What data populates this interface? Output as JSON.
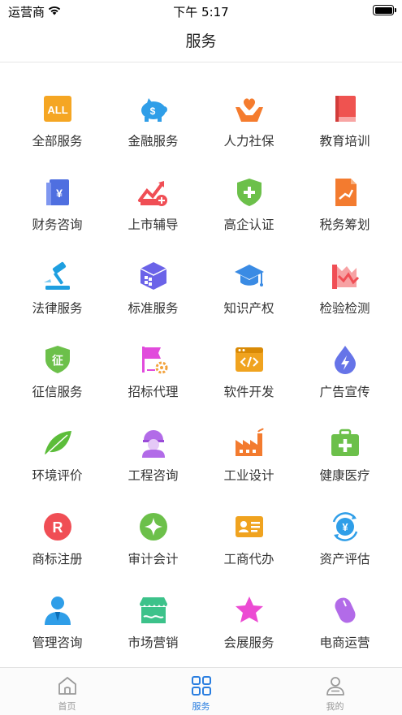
{
  "status_bar": {
    "carrier": "运营商",
    "time": "下午 5:17"
  },
  "header": {
    "title": "服务"
  },
  "services": [
    {
      "label": "全部服务",
      "icon": "all-icon"
    },
    {
      "label": "金融服务",
      "icon": "piggy-bank-icon"
    },
    {
      "label": "人力社保",
      "icon": "hands-heart-icon"
    },
    {
      "label": "教育培训",
      "icon": "book-icon"
    },
    {
      "label": "财务咨询",
      "icon": "finance-doc-icon"
    },
    {
      "label": "上市辅导",
      "icon": "growth-chart-icon"
    },
    {
      "label": "高企认证",
      "icon": "shield-plus-icon"
    },
    {
      "label": "税务筹划",
      "icon": "tax-doc-icon"
    },
    {
      "label": "法律服务",
      "icon": "gavel-icon"
    },
    {
      "label": "标准服务",
      "icon": "cube-icon"
    },
    {
      "label": "知识产权",
      "icon": "graduation-cap-icon"
    },
    {
      "label": "检验检测",
      "icon": "inspection-icon"
    },
    {
      "label": "征信服务",
      "icon": "credit-shield-icon"
    },
    {
      "label": "招标代理",
      "icon": "flag-gear-icon"
    },
    {
      "label": "软件开发",
      "icon": "code-window-icon"
    },
    {
      "label": "广告宣传",
      "icon": "drop-bolt-icon"
    },
    {
      "label": "环境评价",
      "icon": "leaf-icon"
    },
    {
      "label": "工程咨询",
      "icon": "worker-icon"
    },
    {
      "label": "工业设计",
      "icon": "factory-icon"
    },
    {
      "label": "健康医疗",
      "icon": "medical-kit-icon"
    },
    {
      "label": "商标注册",
      "icon": "trademark-icon"
    },
    {
      "label": "审计会计",
      "icon": "audit-icon"
    },
    {
      "label": "工商代办",
      "icon": "id-card-icon"
    },
    {
      "label": "资产评估",
      "icon": "yen-cycle-icon"
    },
    {
      "label": "管理咨询",
      "icon": "manager-icon"
    },
    {
      "label": "市场营销",
      "icon": "storefront-icon"
    },
    {
      "label": "会展服务",
      "icon": "star-icon"
    },
    {
      "label": "电商运营",
      "icon": "mouse-icon"
    }
  ],
  "tab_bar": [
    {
      "label": "首页",
      "icon": "home-icon",
      "active": false
    },
    {
      "label": "服务",
      "icon": "grid-icon",
      "active": true
    },
    {
      "label": "我的",
      "icon": "user-icon",
      "active": false
    }
  ],
  "colors": {
    "active_tab": "#2a7ee0",
    "inactive_tab": "#999999"
  }
}
